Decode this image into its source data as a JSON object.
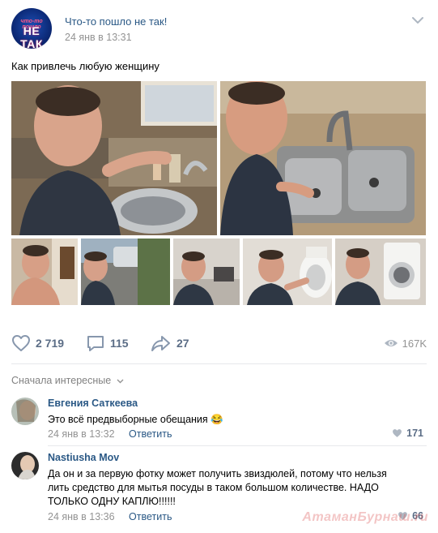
{
  "post": {
    "group_name": "Что-то пошло не так!",
    "time": "24 янв в 13:31",
    "text": "Как привлечь любую женщину",
    "avatar_logo_top": "что-то пошло",
    "avatar_logo_main": "НЕ ТАК"
  },
  "actions": {
    "likes": "2 719",
    "comments": "115",
    "shares": "27",
    "views": "167K"
  },
  "comments_sort": "Сначала интересные",
  "comments": [
    {
      "author": "Евгения Саткеева",
      "text": "Это всё предвыборные обещания 😂",
      "time": "24 янв в 13:32",
      "reply": "Ответить",
      "likes": "171"
    },
    {
      "author": "Nastiusha Mov",
      "text_lines": [
        "Да он и за первую фотку может получить звиздюлей, потому что нельзя",
        "лить средство для мытья посуды в таком большом количестве. НАДО",
        "ТОЛЬКО ОДНУ КАПЛЮ!!!!!!"
      ],
      "time": "24 янв в 13:36",
      "reply": "Ответить",
      "likes": "66"
    }
  ],
  "watermark": "АтаманБурнаш.ru",
  "colors": {
    "link": "#2a5885",
    "meta": "#939393",
    "action": "#5b6d86",
    "divider": "#e7e8ec"
  }
}
